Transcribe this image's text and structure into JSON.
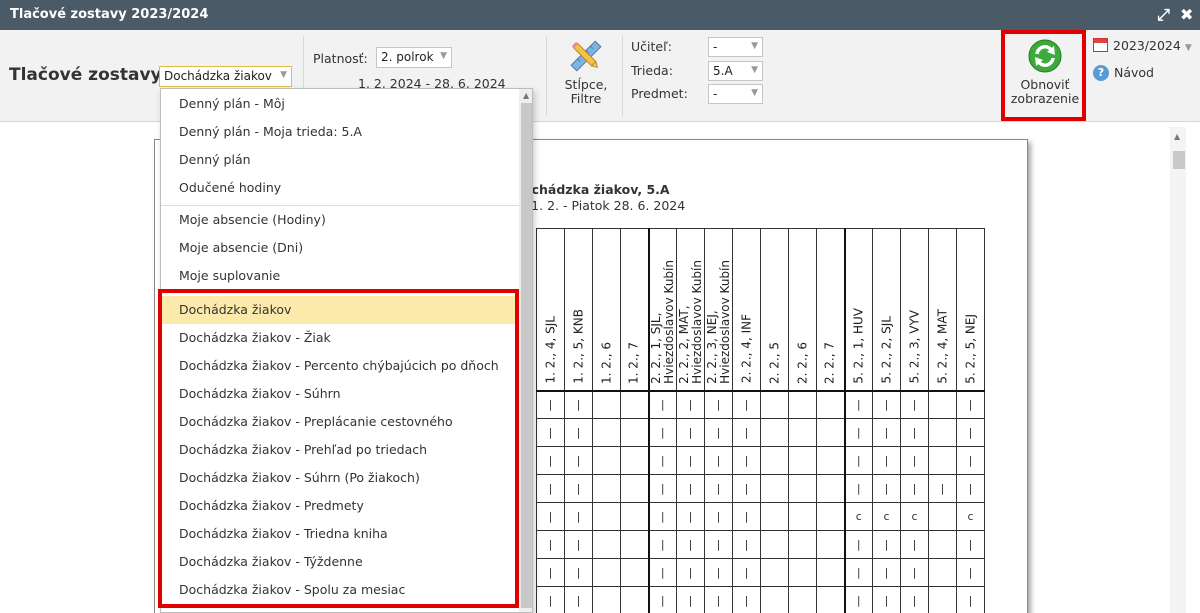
{
  "window": {
    "title": "Tlačové zostavy 2023/2024"
  },
  "toolbar": {
    "heading": "Tlačové zostavy:",
    "report_select": "Dochádzka žiakov",
    "validity_label": "Platnosť:",
    "validity_value": "2. polrok",
    "validity_range": "1. 2. 2024 - 28. 6. 2024",
    "columns_filter_label": "Stĺpce,\nFiltre",
    "teacher_label": "Učiteľ:",
    "teacher_value": "-",
    "class_label": "Trieda:",
    "class_value": "5.A",
    "subject_label": "Predmet:",
    "subject_value": "-",
    "refresh_label": "Obnoviť\nzobrazenie",
    "school_year": "2023/2024",
    "help_label": "Návod"
  },
  "dropdown": {
    "group1": [
      "Denný plán - Môj",
      "Denný plán - Moja trieda: 5.A",
      "Denný plán",
      "Odučené hodiny"
    ],
    "group2": [
      "Moje absencie (Hodiny)",
      "Moje absencie (Dni)",
      "Moje suplovanie"
    ],
    "group3": [
      "Dochádzka žiakov",
      "Dochádzka žiakov - Žiak",
      "Dochádzka žiakov - Percento chýbajúcich po dňoch",
      "Dochádzka žiakov - Súhrn",
      "Dochádzka žiakov - Preplácanie cestovného",
      "Dochádzka žiakov - Prehľad po triedach",
      "Dochádzka žiakov - Súhrn (Po žiakoch)",
      "Dochádzka žiakov - Predmety",
      "Dochádzka žiakov - Triedna kniha",
      "Dochádzka žiakov - Týždenne",
      "Dochádzka žiakov - Spolu za mesiac"
    ],
    "selected": "Dochádzka žiakov"
  },
  "report": {
    "title": "ochádzka žiakov, 5.A",
    "date_range": ": 1. 2. - Piatok 28. 6. 2024",
    "columns": [
      "1. 2., 4, SJL",
      "1. 2., 5, KNB",
      "1. 2., 6",
      "1. 2., 7",
      "2. 2., 1, SJL,\nHviezdoslavov Kubín",
      "2. 2., 2, MAT,\nHviezdoslavov Kubín",
      "2. 2., 3, NEJ,\nHviezdoslavov Kubín",
      "2. 2., 4, INF",
      "2. 2., 5",
      "2. 2., 6",
      "2. 2., 7",
      "5. 2., 1, HUV",
      "5. 2., 2, SJL",
      "5. 2., 3, VYV",
      "5. 2., 4, MAT",
      "5. 2., 5, NEJ"
    ],
    "rows": [
      [
        "|",
        "|",
        "",
        "",
        "|",
        "|",
        "|",
        "|",
        "",
        "",
        "",
        "|",
        "|",
        "|",
        "",
        "|"
      ],
      [
        "|",
        "|",
        "",
        "",
        "|",
        "|",
        "|",
        "|",
        "",
        "",
        "",
        "|",
        "|",
        "|",
        "",
        "|"
      ],
      [
        "|",
        "|",
        "",
        "",
        "|",
        "|",
        "|",
        "|",
        "",
        "",
        "",
        "|",
        "|",
        "|",
        "",
        "|"
      ],
      [
        "|",
        "|",
        "",
        "",
        "|",
        "|",
        "|",
        "|",
        "",
        "",
        "",
        "|",
        "|",
        "|",
        "|",
        "|"
      ],
      [
        "|",
        "|",
        "",
        "",
        "|",
        "|",
        "|",
        "|",
        "",
        "",
        "",
        "c",
        "c",
        "c",
        "",
        "c"
      ],
      [
        "|",
        "|",
        "",
        "",
        "|",
        "|",
        "|",
        "|",
        "",
        "",
        "",
        "|",
        "|",
        "|",
        "",
        "|"
      ],
      [
        "|",
        "|",
        "",
        "",
        "|",
        "|",
        "|",
        "|",
        "",
        "",
        "",
        "|",
        "|",
        "|",
        "",
        "|"
      ],
      [
        "|",
        "|",
        "",
        "",
        "|",
        "|",
        "|",
        "|",
        "",
        "",
        "",
        "|",
        "|",
        "|",
        "",
        "|"
      ]
    ]
  }
}
